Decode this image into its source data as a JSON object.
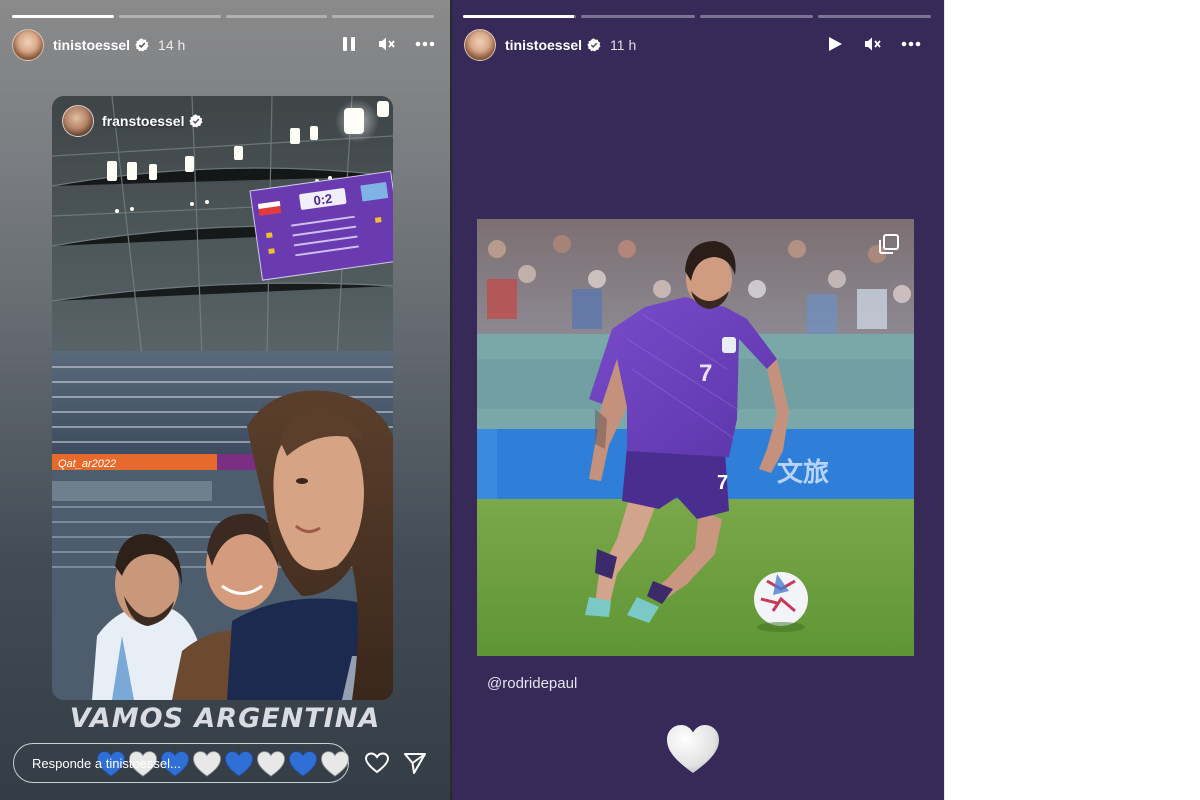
{
  "story1": {
    "username": "tinistoessel",
    "time": "14 h",
    "progress": [
      1.0,
      0,
      0,
      0
    ],
    "shared_story": {
      "username": "franstoessel",
      "scoreboard": {
        "score": "0:2"
      },
      "banner": "Qat_ar2022"
    },
    "caption": "VAMOS ARGENTINA",
    "reply_placeholder": "Responde a tinistoessel...",
    "quick_reactions": [
      "blue-heart",
      "white-heart",
      "blue-heart",
      "white-heart",
      "blue-heart",
      "white-heart",
      "blue-heart",
      "white-heart"
    ],
    "controls": [
      "pause-icon",
      "mute-icon",
      "more-icon"
    ]
  },
  "story2": {
    "username": "tinistoessel",
    "time": "11 h",
    "progress": [
      0.98,
      0,
      0,
      0
    ],
    "mention": "@rodridepaul",
    "jersey_number": "7",
    "controls": [
      "play-icon",
      "mute-icon",
      "more-icon"
    ]
  },
  "colors": {
    "story2_background": "#372a59",
    "jersey": "#6a3fb8",
    "blue_heart": "#2f6fd6",
    "white_heart": "#e8e8e8"
  }
}
